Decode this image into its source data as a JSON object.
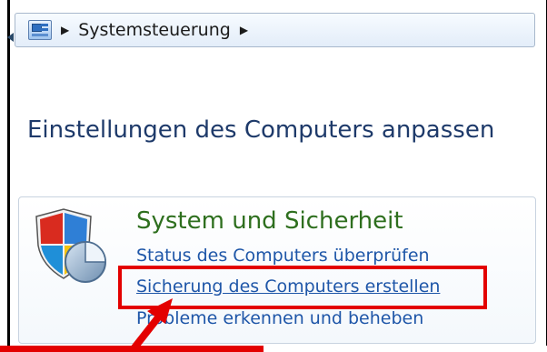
{
  "breadcrumb": {
    "items": [
      "Systemsteuerung"
    ],
    "separator": "▶"
  },
  "page": {
    "title": "Einstellungen des Computers anpassen"
  },
  "category": {
    "title": "System und Sicherheit",
    "icon": "shield-icon",
    "links": [
      "Status des Computers überprüfen",
      "Sicherung des Computers erstellen",
      "Probleme erkennen und beheben"
    ]
  },
  "annotation": {
    "highlighted_link": "Sicherung des Computers erstellen",
    "color": "#e30000"
  },
  "colors": {
    "title_blue": "#1e3a6a",
    "category_green": "#2e6f1e",
    "link_blue": "#1e56a8"
  }
}
